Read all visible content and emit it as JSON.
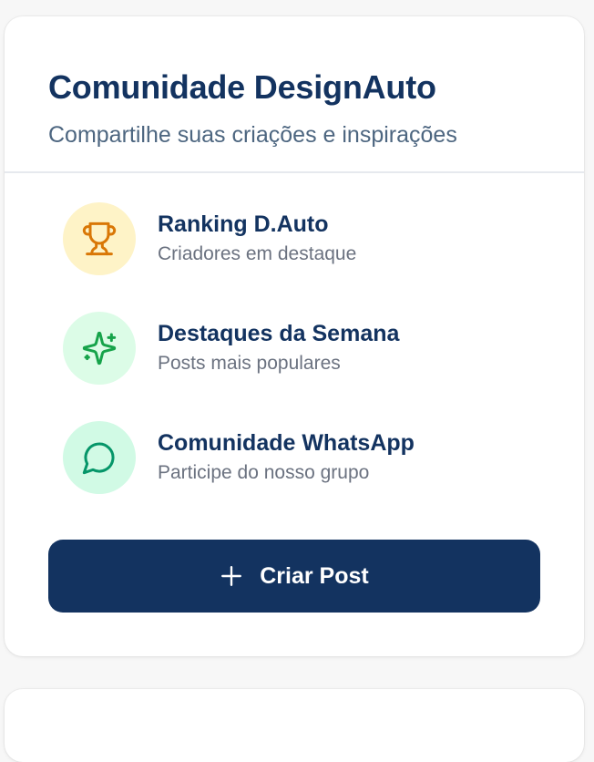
{
  "community": {
    "title": "Comunidade DesignAuto",
    "subtitle": "Compartilhe suas criações e inspirações",
    "items": [
      {
        "label": "Ranking D.Auto",
        "description": "Criadores em destaque",
        "icon": "trophy-icon",
        "icon_color": "#d97706",
        "bg_color": "#fef3c7"
      },
      {
        "label": "Destaques da Semana",
        "description": "Posts mais populares",
        "icon": "sparkles-icon",
        "icon_color": "#16a34a",
        "bg_color": "#dcfce7"
      },
      {
        "label": "Comunidade WhatsApp",
        "description": "Participe do nosso grupo",
        "icon": "message-circle-icon",
        "icon_color": "#059669",
        "bg_color": "#d1fae5"
      }
    ],
    "cta_label": "Criar Post",
    "cta_icon": "plus-icon",
    "accent_color": "#133360"
  }
}
